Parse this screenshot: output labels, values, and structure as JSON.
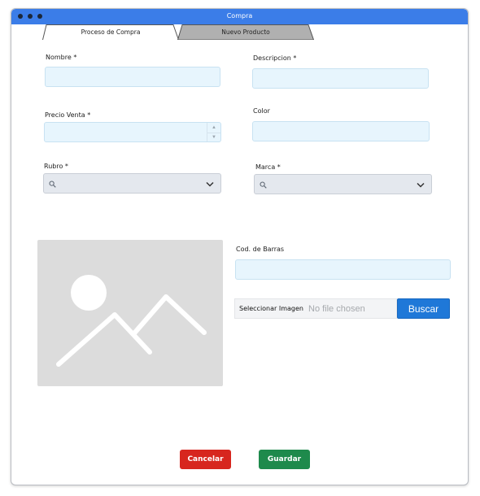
{
  "window": {
    "title": "Compra"
  },
  "tabs": [
    {
      "label": "Proceso de Compra",
      "active": true
    },
    {
      "label": "Nuevo Producto",
      "active": false
    }
  ],
  "form": {
    "nombre": {
      "label": "Nombre *",
      "value": ""
    },
    "descripcion": {
      "label": "Descripcion *",
      "value": ""
    },
    "precio_venta": {
      "label": "Precio Venta *",
      "value": ""
    },
    "color": {
      "label": "Color",
      "value": ""
    },
    "rubro": {
      "label": "Rubro *",
      "value": ""
    },
    "marca": {
      "label": "Marca *",
      "value": ""
    },
    "cod_barras": {
      "label": "Cod. de Barras",
      "value": ""
    }
  },
  "image_upload": {
    "button_label": "Seleccionar Imagen",
    "status": "No file chosen",
    "search_label": "Buscar"
  },
  "actions": {
    "cancel_label": "Cancelar",
    "save_label": "Guardar"
  },
  "colors": {
    "titlebar": "#3b7de8",
    "input_bg": "#e7f5fd",
    "cancel": "#d7261e",
    "save": "#1e8a4c",
    "search": "#1f78d8"
  },
  "icons": [
    "search-icon",
    "chevron-down-icon",
    "image-placeholder-icon",
    "spin-up-icon",
    "spin-down-icon"
  ]
}
